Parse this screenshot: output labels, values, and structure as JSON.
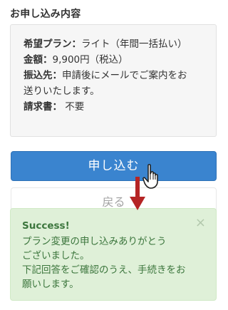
{
  "section": {
    "title": "お申し込み内容"
  },
  "summary": {
    "plan_key": "希望プラン：",
    "plan_value": "ライト（年間一括払い）",
    "amount_key": "金額：",
    "amount_value": "9,900円（税込）",
    "payee_key": "振込先：",
    "payee_value_line1": "申請後にメールでご案内をお",
    "payee_value_line2": "送りいたします。",
    "invoice_key": "請求書：",
    "invoice_value": " 不要"
  },
  "buttons": {
    "submit_label": "申し込む",
    "back_label": "戻る"
  },
  "alert": {
    "title": "Success!",
    "line1": "プラン変更の申し込みありがとう",
    "line2": "ございました。",
    "line3": "下記回答をご確認のうえ、手続きをお",
    "line4": "願いします。",
    "close_symbol": "×"
  },
  "colors": {
    "primary": "#3a84cf",
    "success_bg": "#dff0d8",
    "success_text": "#3c763d",
    "arrow": "#b52525"
  },
  "icons": {
    "cursor": "hand-pointer-icon",
    "arrow": "arrow-down-icon",
    "close": "close-icon"
  }
}
